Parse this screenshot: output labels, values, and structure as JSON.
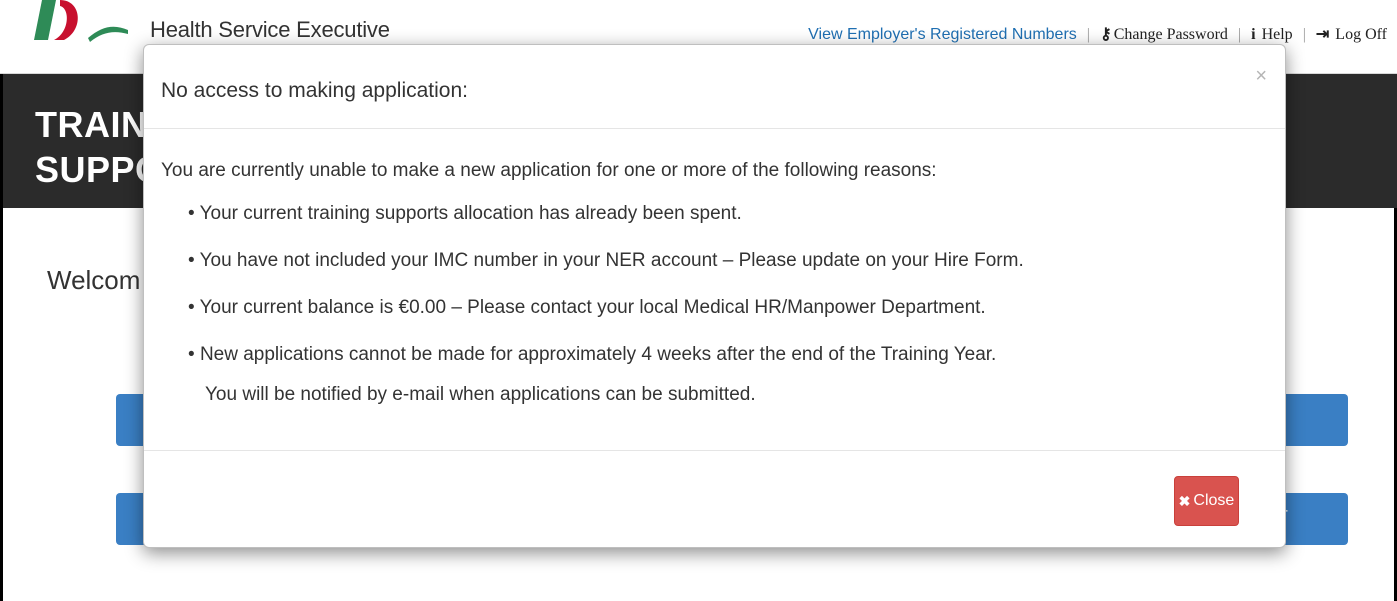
{
  "header": {
    "site_title": "Health Service Executive",
    "links": {
      "employer": "View Employer's Registered Numbers",
      "separator": "|",
      "change_password": "Change Password",
      "help": "Help",
      "log_off": "Log Off"
    },
    "icons": {
      "key": "key-icon",
      "info": "info-icon",
      "logout": "sign-out-icon"
    }
  },
  "banner": {
    "line1": "TRAINI",
    "line2": "SUPPO"
  },
  "page": {
    "welcome": "Welcom",
    "button1_tail": "→",
    "button2_tail": "T"
  },
  "modal": {
    "title": "No access to making application:",
    "close_x": "×",
    "intro": "You are currently unable to make a new application for one or more of the following reasons:",
    "reasons": [
      "Your current training supports allocation has already been spent.",
      "You have not included your IMC number in your NER account – Please update on your Hire Form.",
      "Your current balance is €0.00 – Please contact your local Medical HR/Manpower Department.",
      "New applications cannot be made for approximately 4 weeks after the end of the Training Year."
    ],
    "note": "You will be notified by e-mail when applications can be submitted.",
    "close_button": {
      "icon": "✖",
      "label": "Close"
    }
  },
  "colors": {
    "banner": "#2b2b2b",
    "primary_button": "#3a7fc4",
    "danger_button": "#d9534f",
    "link": "#1f6fb2",
    "logo_red": "#c8102e",
    "logo_green": "#2e8b57"
  }
}
